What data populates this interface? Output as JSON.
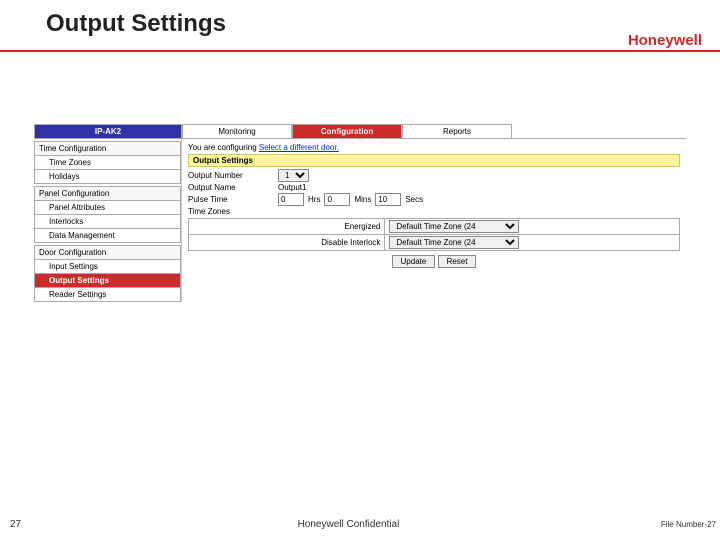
{
  "slide": {
    "title": "Output Settings",
    "brand": "Honeywell"
  },
  "footer": {
    "page_number": "27",
    "confidential": "Honeywell Confidential",
    "file_label": "File Number-",
    "file_number": "27"
  },
  "tabs": {
    "ipak2": "IP-AK2",
    "monitoring": "Monitoring",
    "configuration": "Configuration",
    "reports": "Reports"
  },
  "sidebar": {
    "time_group": "Time Configuration",
    "time_zones": "Time Zones",
    "holidays": "Holidays",
    "panel_group": "Panel Configuration",
    "panel_attributes": "Panel Attributes",
    "interlocks": "Interlocks",
    "data_management": "Data Management",
    "door_group": "Door Configuration",
    "input_settings": "Input Settings",
    "output_settings": "Output Settings",
    "reader_settings": "Reader Settings"
  },
  "cfg_line": {
    "prefix": "You are configuring ",
    "link": "Select a different door."
  },
  "section": {
    "title": "Output Settings"
  },
  "form": {
    "output_number_label": "Output Number",
    "output_number_value": "1",
    "output_name_label": "Output Name",
    "output_name_value": "Output1",
    "pulse_time_label": "Pulse Time",
    "hrs_value": "0",
    "hrs_label": "Hrs",
    "mins_value": "0",
    "mins_label": "Mins",
    "secs_value": "10",
    "secs_label": "Secs",
    "time_zones_label": "Time Zones"
  },
  "inner_table": {
    "energized_label": "Energized",
    "energized_value": "Default Time Zone (24",
    "disable_interlock_label": "Disable Interlock",
    "disable_interlock_value": "Default Time Zone (24"
  },
  "buttons": {
    "update": "Update",
    "reset": "Reset"
  }
}
